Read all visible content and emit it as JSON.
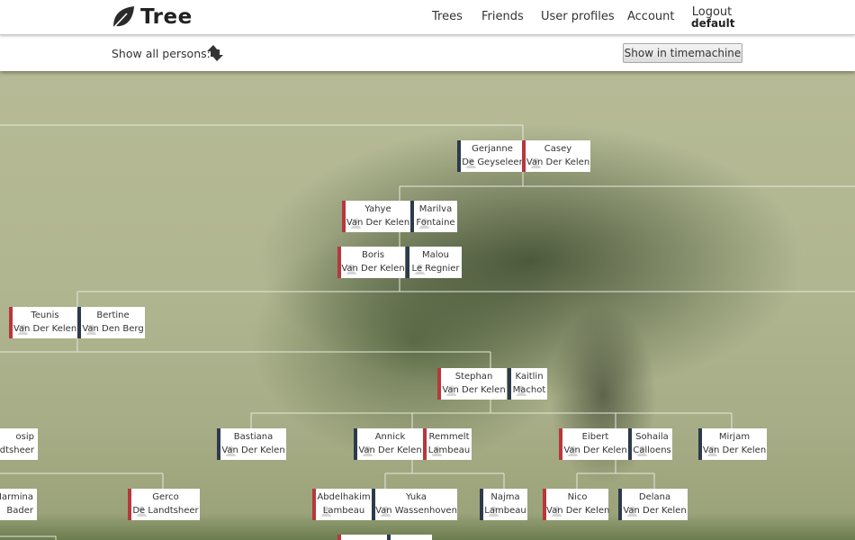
{
  "header": {
    "logo_text": "Tree",
    "logo_icon": "leaf-icon",
    "nav": [
      "Trees",
      "Friends",
      "User profiles",
      "Account"
    ],
    "logout_label": "Logout",
    "username": "default"
  },
  "toolbar": {
    "show_all_label": "Show all persons:",
    "swap_icon": "swap-arrows-icon",
    "timemachine_button": "Show in timemachine"
  },
  "colors": {
    "male": "#2d3a4c",
    "female": "#b8373d",
    "line": "#e6e8dc"
  },
  "persons": [
    {
      "first": "Gerjanne",
      "last": "De Geyseleer",
      "sex": "m"
    },
    {
      "first": "Casey",
      "last": "Van Der Kelen",
      "sex": "f"
    },
    {
      "first": "Yahye",
      "last": "Van Der Kelen",
      "sex": "f"
    },
    {
      "first": "Marilva",
      "last": "Fontaine",
      "sex": "m"
    },
    {
      "first": "Boris",
      "last": "Van Der Kelen",
      "sex": "f"
    },
    {
      "first": "Malou",
      "last": "Le Regnier",
      "sex": "m"
    },
    {
      "first": "Teunis",
      "last": "Van Der Kelen",
      "sex": "f"
    },
    {
      "first": "Bertine",
      "last": "Van Den Berg",
      "sex": "m"
    },
    {
      "first": "Stephan",
      "last": "Van Der Kelen",
      "sex": "f"
    },
    {
      "first": "Kaitlin",
      "last": "Machot",
      "sex": "m"
    },
    {
      "first": "osip",
      "last": "dtsheer",
      "sex": "m"
    },
    {
      "first": "Bastiana",
      "last": "Van Der Kelen",
      "sex": "m"
    },
    {
      "first": "Annick",
      "last": "Van Der Kelen",
      "sex": "m"
    },
    {
      "first": "Remmelt",
      "last": "Lambeau",
      "sex": "f"
    },
    {
      "first": "Eibert",
      "last": "Van Der Kelen",
      "sex": "f"
    },
    {
      "first": "Sohaila",
      "last": "Calloens",
      "sex": "m"
    },
    {
      "first": "Mirjam",
      "last": "Van Der Kelen",
      "sex": "m"
    },
    {
      "first": "Harmina",
      "last": "Bader",
      "sex": "m"
    },
    {
      "first": "Gerco",
      "last": "De Landtsheer",
      "sex": "f"
    },
    {
      "first": "Abdelhakim",
      "last": "Lambeau",
      "sex": "f"
    },
    {
      "first": "Yuka",
      "last": "Van Wassenhoven",
      "sex": "m"
    },
    {
      "first": "Najma",
      "last": "Lambeau",
      "sex": "m"
    },
    {
      "first": "Nico",
      "last": "Van Der Kelen",
      "sex": "f"
    },
    {
      "first": "Delana",
      "last": "Van Der Kelen",
      "sex": "m"
    }
  ]
}
